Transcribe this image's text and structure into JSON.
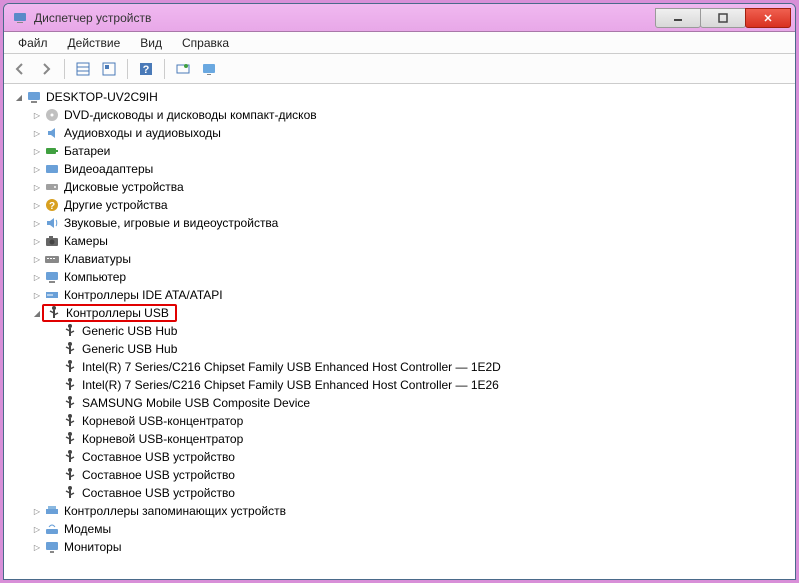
{
  "title": "Диспетчер устройств",
  "menu": {
    "file": "Файл",
    "action": "Действие",
    "view": "Вид",
    "help": "Справка"
  },
  "root": "DESKTOP-UV2C9IH",
  "categories": [
    {
      "icon": "disc",
      "label": "DVD-дисководы и дисководы компакт-дисков"
    },
    {
      "icon": "audio",
      "label": "Аудиовходы и аудиовыходы"
    },
    {
      "icon": "battery",
      "label": "Батареи"
    },
    {
      "icon": "video",
      "label": "Видеоадаптеры"
    },
    {
      "icon": "disk",
      "label": "Дисковые устройства"
    },
    {
      "icon": "other",
      "label": "Другие устройства"
    },
    {
      "icon": "media",
      "label": "Звуковые, игровые и видеоустройства"
    },
    {
      "icon": "camera",
      "label": "Камеры"
    },
    {
      "icon": "keyboard",
      "label": "Клавиатуры"
    },
    {
      "icon": "pc",
      "label": "Компьютер"
    },
    {
      "icon": "ide",
      "label": "Контроллеры IDE ATA/ATAPI"
    }
  ],
  "usb_category": "Контроллеры USB",
  "usb_devices": [
    "Generic USB Hub",
    "Generic USB Hub",
    "Intel(R) 7 Series/C216 Chipset Family USB Enhanced Host Controller — 1E2D",
    "Intel(R) 7 Series/C216 Chipset Family USB Enhanced Host Controller — 1E26",
    "SAMSUNG Mobile USB Composite Device",
    "Корневой USB-концентратор",
    "Корневой USB-концентратор",
    "Составное USB устройство",
    "Составное USB устройство",
    "Составное USB устройство"
  ],
  "after_categories": [
    {
      "icon": "storage",
      "label": "Контроллеры запоминающих устройств"
    },
    {
      "icon": "modem",
      "label": "Модемы"
    },
    {
      "icon": "monitor",
      "label": "Мониторы"
    }
  ]
}
